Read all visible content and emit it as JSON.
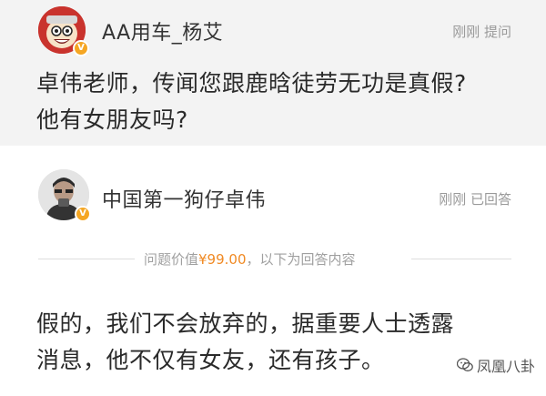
{
  "question": {
    "username": "AA用车_杨艾",
    "meta": "刚刚 提问",
    "text_line1": "卓伟老师，传闻您跟鹿晗徒劳无功是真假?",
    "text_line2": "他有女朋友吗?",
    "avatar_icon": "cartoon-mascot-icon",
    "verified_icon": "verified-badge-icon"
  },
  "answer": {
    "username": "中国第一狗仔卓伟",
    "meta": "刚刚 已回答",
    "price_prefix": "问题价值",
    "price": "¥99.00",
    "price_suffix": "，以下为回答内容",
    "text_line1": "假的，我们不会放弃的，据重要人士透露",
    "text_line2": "消息，他不仅有女友，还有孩子。",
    "avatar_icon": "person-photo-icon",
    "verified_icon": "verified-badge-icon"
  },
  "watermark": {
    "text": "凤凰八卦",
    "icon": "wechat-icon"
  },
  "colors": {
    "question_bg": "#f3f3f3",
    "price": "#f08a24",
    "badge": "#f5a623",
    "meta_text": "#9a9a9a"
  }
}
